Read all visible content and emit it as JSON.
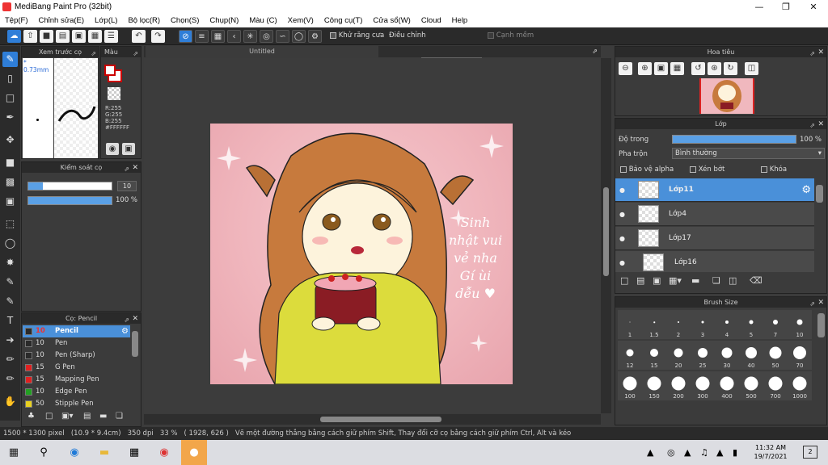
{
  "title": "MediBang Paint Pro (32bit)",
  "menu": [
    "Tệp(F)",
    "Chỉnh sửa(E)",
    "Lớp(L)",
    "Bộ lọc(R)",
    "Chọn(S)",
    "Chụp(N)",
    "Màu (C)",
    "Xem(V)",
    "Công cụ(T)",
    "Cửa sổ(W)",
    "Cloud",
    "Help"
  ],
  "toolbar": {
    "antialias_label": "Khử răng cưa",
    "adjust_label": "Điều chỉnh",
    "adjust_value": "20",
    "edge_label": "Cạnh mềm"
  },
  "preview_panel": {
    "title": "Xem trước cọ",
    "size_label": "* 0.73mm"
  },
  "color_panel": {
    "title": "Màu",
    "r": "R:255",
    "g": "G:255",
    "b": "B:255",
    "hex": "#FFFFFF"
  },
  "brush_control": {
    "title": "Kiểm soát cọ",
    "size_value": "10",
    "opacity_value": "100 %"
  },
  "brush_list": {
    "title": "Cọ: Pencil",
    "items": [
      {
        "size": "10",
        "name": "Pencil",
        "color": "#2a2a2a"
      },
      {
        "size": "10",
        "name": "Pen",
        "color": "#2a2a2a"
      },
      {
        "size": "10",
        "name": "Pen (Sharp)",
        "color": "#2a2a2a"
      },
      {
        "size": "15",
        "name": "G Pen",
        "color": "#e02020"
      },
      {
        "size": "15",
        "name": "Mapping Pen",
        "color": "#e02020"
      },
      {
        "size": "10",
        "name": "Edge Pen",
        "color": "#22a022"
      },
      {
        "size": "50",
        "name": "Stipple Pen",
        "color": "#e8d020"
      }
    ]
  },
  "canvas": {
    "tab_title": "Untitled",
    "text_lines": [
      "Sinh",
      "nhật vui",
      "vẻ nha",
      "Gí ùi",
      "dễu"
    ]
  },
  "navigator": {
    "title": "Hoa tiêu"
  },
  "layer_panel": {
    "title": "Lớp",
    "opacity_label": "Độ trong",
    "opacity_value": "100 %",
    "opacity_fraction": 1.0,
    "blend_label": "Pha trộn",
    "blend_value": "Bình thường",
    "protect_alpha": "Bảo vệ alpha",
    "clipping": "Xén bớt",
    "lock": "Khóa",
    "layers": [
      "Lớp11",
      "Lớp4",
      "Lớp17",
      "Lớp16"
    ]
  },
  "brush_size": {
    "title": "Brush Size",
    "sizes": [
      "1",
      "1.5",
      "2",
      "3",
      "4",
      "5",
      "7",
      "10",
      "12",
      "15",
      "20",
      "25",
      "30",
      "40",
      "50",
      "70",
      "100",
      "150",
      "200",
      "300",
      "400",
      "500",
      "700",
      "1000"
    ]
  },
  "status": {
    "text": "1500 * 1300 pixel   (10.9 * 9.4cm)   350 dpi   33 %   ( 1928, 626 )   Vẽ một đường thẳng bằng cách giữ phím Shift, Thay đổi cỡ cọ bằng cách giữ phím Ctrl, Alt và kéo"
  },
  "taskbar": {
    "time": "11:32 AM",
    "date": "19/7/2021",
    "notif_count": "2"
  }
}
